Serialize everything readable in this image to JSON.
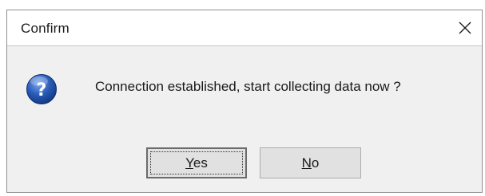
{
  "window": {
    "title": "Confirm",
    "close_icon": "close-icon"
  },
  "message": {
    "icon": "question-icon",
    "text": "Connection established, start collecting data now ?"
  },
  "buttons": {
    "yes": {
      "mnemonic": "Y",
      "rest": "es",
      "focused": true
    },
    "no": {
      "mnemonic": "N",
      "rest": "o"
    }
  },
  "colors": {
    "dialog_bg": "#f0f0f0",
    "titlebar_bg": "#ffffff",
    "button_bg": "#e1e1e1",
    "icon_blue": "#2a5cb8"
  }
}
